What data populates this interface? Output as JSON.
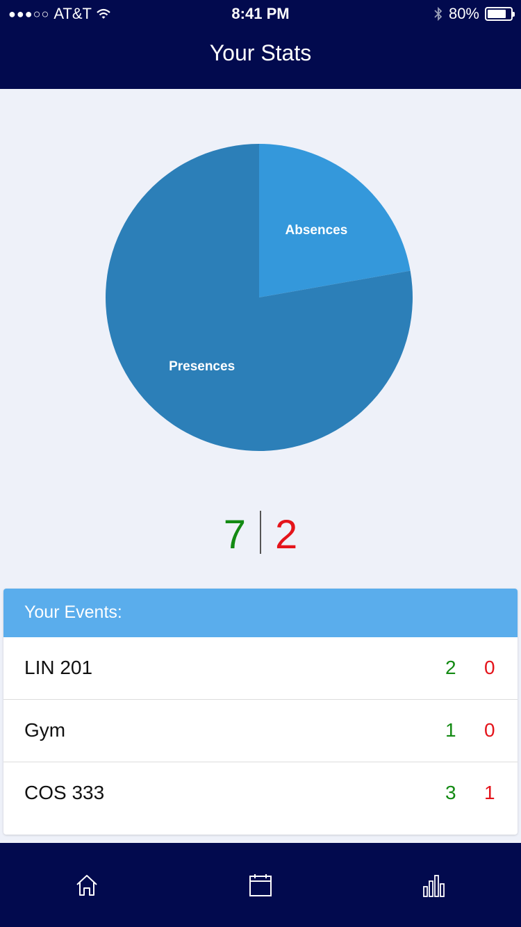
{
  "status_bar": {
    "signal": "●●●○○",
    "carrier": "AT&T",
    "time": "8:41 PM",
    "battery_percent": "80%",
    "battery_level": 0.8
  },
  "header": {
    "title": "Your Stats"
  },
  "chart_data": {
    "type": "pie",
    "labels": [
      "Absences",
      "Presences"
    ],
    "values": [
      2,
      7
    ],
    "colors": [
      "#3498db",
      "#2c7fb8"
    ]
  },
  "summary": {
    "presences": "7",
    "absences": "2"
  },
  "events": {
    "title": "Your Events:",
    "rows": [
      {
        "name": "LIN 201",
        "present": "2",
        "absent": "0"
      },
      {
        "name": "Gym",
        "present": "1",
        "absent": "0"
      },
      {
        "name": "COS 333",
        "present": "3",
        "absent": "1"
      }
    ]
  },
  "tab_bar": {
    "items": [
      {
        "icon": "home-icon"
      },
      {
        "icon": "calendar-icon"
      },
      {
        "icon": "stats-icon"
      }
    ]
  },
  "colors": {
    "nav_background": "#020a4e",
    "page_background": "#eef1f9",
    "events_header": "#5aadec",
    "present_green": "#138a13",
    "absent_red": "#e4141b"
  }
}
